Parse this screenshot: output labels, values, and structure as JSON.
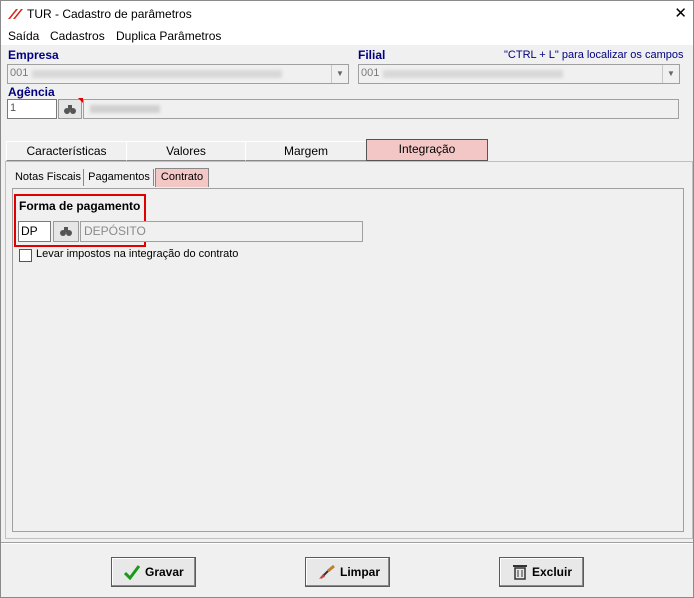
{
  "window": {
    "title": "TUR - Cadastro de parâmetros",
    "close_glyph": "✕"
  },
  "menu": [
    "Saída",
    "Cadastros",
    "Duplica Parâmetros"
  ],
  "header": {
    "empresa_label": "Empresa",
    "empresa_code": "001",
    "filial_label": "Filial",
    "filial_code": "001",
    "hint": "\"CTRL + L\" para localizar os campos",
    "agencia_label": "Agência",
    "agencia_value": "1"
  },
  "tabs": [
    "Características",
    "Valores",
    "Margem",
    "Integração"
  ],
  "subtabs": [
    "Notas Fiscais",
    "Pagamentos",
    "Contrato"
  ],
  "contrato": {
    "forma_label": "Forma de pagamento",
    "forma_code": "DP",
    "forma_desc": "DEPÓSITO",
    "checkbox_label": "Levar impostos na integração do contrato",
    "checkbox_checked": false
  },
  "buttons": {
    "gravar": "Gravar",
    "limpar": "Limpar",
    "excluir": "Excluir"
  },
  "colors": {
    "active_tab": "#f4c7c7",
    "highlight": "#e00000",
    "label_blue": "#000080"
  }
}
